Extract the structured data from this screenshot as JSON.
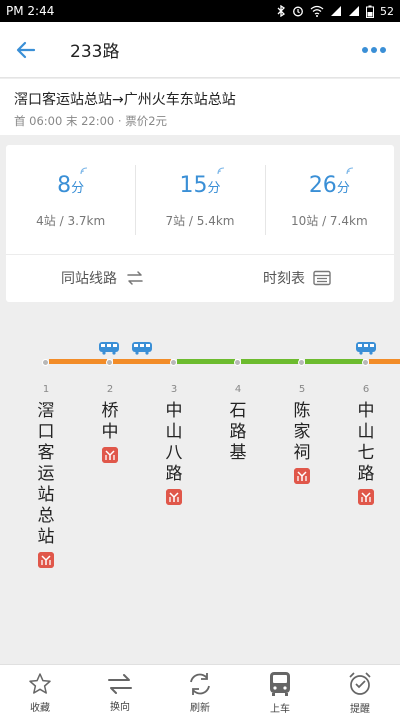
{
  "status_bar": {
    "time": "PM 2:44",
    "battery": "52"
  },
  "header": {
    "title": "233路"
  },
  "route": {
    "direction": "滘口客运站总站→广州火车东站总站",
    "hours": "首 06:00 末 22:00 · 票价2元"
  },
  "arrivals": [
    {
      "minutes": "8",
      "unit": "分",
      "distance": "4站 / 3.7km"
    },
    {
      "minutes": "15",
      "unit": "分",
      "distance": "7站 / 5.4km"
    },
    {
      "minutes": "26",
      "unit": "分",
      "distance": "10站 / 7.4km"
    }
  ],
  "actions": {
    "same_station_routes": "同站线路",
    "timetable": "时刻表"
  },
  "stops": [
    {
      "number": "1",
      "name": "滘口客运站总站",
      "metro": true
    },
    {
      "number": "2",
      "name": "桥中",
      "metro": true
    },
    {
      "number": "3",
      "name": "中山八路",
      "metro": true
    },
    {
      "number": "4",
      "name": "石路基",
      "metro": false
    },
    {
      "number": "5",
      "name": "陈家祠",
      "metro": true
    },
    {
      "number": "6",
      "name": "中山七路",
      "metro": true
    }
  ],
  "traffic_colors": {
    "slow": "#f28c28",
    "fast": "#6cbb2e",
    "accent": "#3a8fd6",
    "metro": "#e0574a"
  },
  "bottom_nav": [
    {
      "label": "收藏",
      "icon": "star-icon"
    },
    {
      "label": "换向",
      "icon": "swap-icon"
    },
    {
      "label": "刷新",
      "icon": "refresh-icon"
    },
    {
      "label": "上车",
      "icon": "bus-board-icon"
    },
    {
      "label": "提醒",
      "icon": "alarm-icon"
    }
  ]
}
